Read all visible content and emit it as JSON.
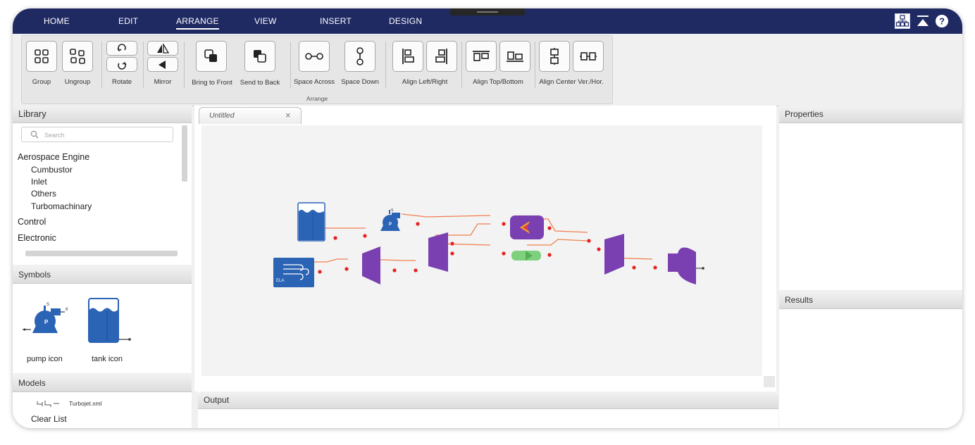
{
  "menu": {
    "items": [
      {
        "label": "HOME"
      },
      {
        "label": "EDIT"
      },
      {
        "label": "ARRANGE"
      },
      {
        "label": "VIEW"
      },
      {
        "label": "INSERT"
      },
      {
        "label": "DESIGN"
      }
    ],
    "active": "ARRANGE",
    "right_icons": [
      "diagram-view-icon",
      "collapse-ribbon-icon",
      "help-icon"
    ]
  },
  "ribbon": {
    "group_label": "Arrange",
    "buttons": {
      "group": "Group",
      "ungroup": "Ungroup",
      "rotate": "Rotate",
      "mirror": "Mirror",
      "bring_to_front": "Bring to Front",
      "send_to_back": "Send to Back",
      "space_across": "Space Across",
      "space_down": "Space Down",
      "align_left_right": "Align Left/Right",
      "align_top_bottom": "Align Top/Bottom",
      "align_center": "Align Center Ver./Hor."
    }
  },
  "library": {
    "title": "Library",
    "search_placeholder": "Search",
    "categories": [
      {
        "label": "Aerospace Engine",
        "children": [
          "Cumbustor",
          "Inlet",
          "Others",
          "Turbomachinary"
        ]
      },
      {
        "label": "Control"
      },
      {
        "label": "Electronic"
      }
    ]
  },
  "symbols": {
    "title": "Symbols",
    "items": [
      {
        "label": "pump icon"
      },
      {
        "label": "tank icon"
      }
    ]
  },
  "models": {
    "title": "Models",
    "file": "Turbojet.xml",
    "clear": "Clear List"
  },
  "editor": {
    "tab_title": "Untitled",
    "diagram": {
      "inlet_label": "ELA"
    }
  },
  "output": {
    "title": "Output"
  },
  "properties": {
    "title": "Properties"
  },
  "results": {
    "title": "Results"
  },
  "colors": {
    "menubar": "#1f2a63",
    "component_blue": "#2b63b5",
    "turbo_purple": "#7a3fb0",
    "wire_orange": "#f08050",
    "node_red": "#e82020",
    "valve_green": "#7ed07e"
  }
}
